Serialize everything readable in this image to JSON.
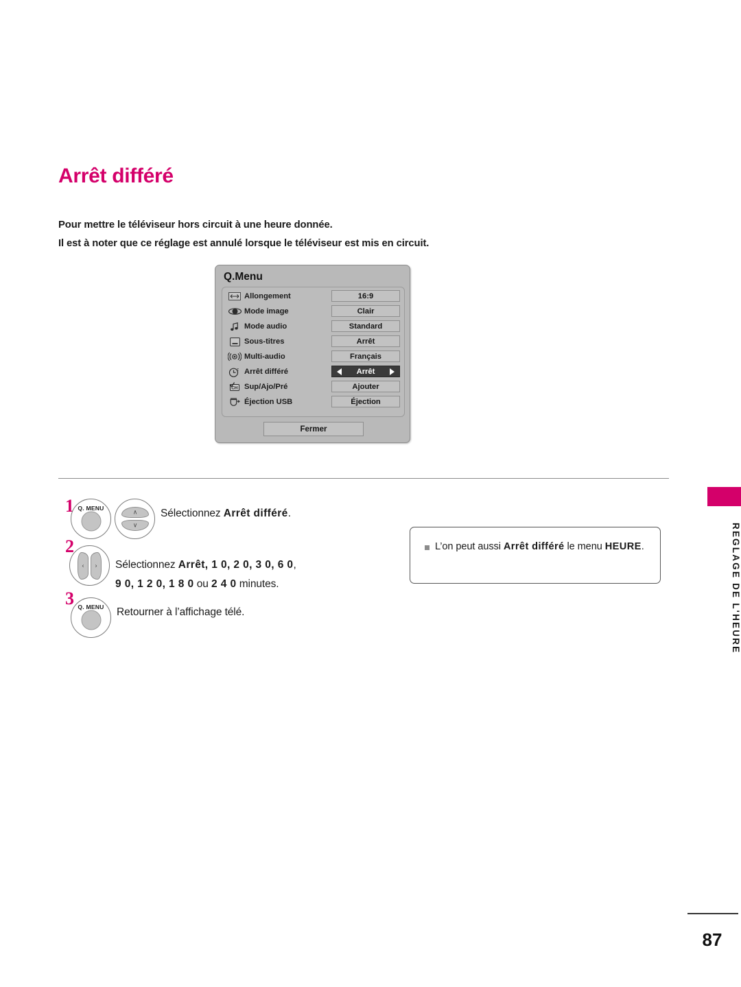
{
  "page": {
    "title": "Arrêt différé",
    "number": "87",
    "sidebar_label": "REGLAGE DE L'HEURE",
    "accent_color": "#D4006A"
  },
  "intro": {
    "line1": "Pour mettre le téléviseur hors circuit à une heure donnée.",
    "line2": "Il est à noter que ce réglage est annulé lorsque le téléviseur est mis en circuit."
  },
  "qmenu": {
    "title": "Q.Menu",
    "close_label": "Fermer",
    "rows": [
      {
        "icon": "stretch-icon",
        "label": "Allongement",
        "value": "16:9",
        "selected": false
      },
      {
        "icon": "eye-icon",
        "label": "Mode image",
        "value": "Clair",
        "selected": false
      },
      {
        "icon": "music-note-icon",
        "label": "Mode audio",
        "value": "Standard",
        "selected": false
      },
      {
        "icon": "subtitle-icon",
        "label": "Sous-titres",
        "value": "Arrêt",
        "selected": false
      },
      {
        "icon": "multi-audio-icon",
        "label": "Multi-audio",
        "value": "Français",
        "selected": false
      },
      {
        "icon": "sleep-timer-icon",
        "label": "Arrêt différé",
        "value": "Arrêt",
        "selected": true
      },
      {
        "icon": "channel-edit-icon",
        "label": "Sup/Ajo/Pré",
        "value": "Ajouter",
        "selected": false
      },
      {
        "icon": "usb-eject-icon",
        "label": "Éjection USB",
        "value": "Éjection",
        "selected": false
      }
    ]
  },
  "steps": [
    {
      "number": "1",
      "button_label": "Q. MENU",
      "text_prefix": "Sélectionnez ",
      "text_bold": "Arrêt différé",
      "text_suffix": "."
    },
    {
      "number": "2",
      "line1_prefix": "Sélectionnez ",
      "line1_bold": "Arrêt, 1 0, 2 0, 3 0, 6 0",
      "line1_suffix": ",",
      "line2_bold_a": "9 0, 1 2 0, 1 8 0",
      "line2_mid": " ou ",
      "line2_bold_b": "2 4 0",
      "line2_suffix": " minutes."
    },
    {
      "number": "3",
      "button_label": "Q. MENU",
      "text": "Retourner à l’affichage télé."
    }
  ],
  "note": {
    "prefix": "L’on peut aussi ",
    "bold1": "Arrêt différé",
    "mid": " le menu ",
    "bold2": "HEURE",
    "suffix": "."
  }
}
